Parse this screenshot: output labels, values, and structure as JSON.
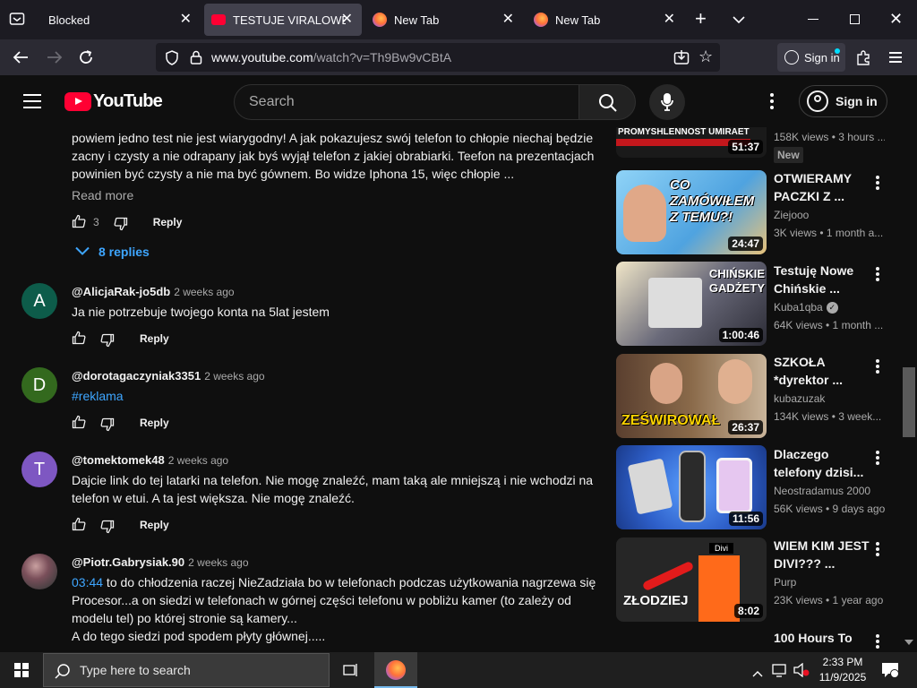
{
  "browser": {
    "tabs": [
      {
        "label": "Blocked"
      },
      {
        "label": "TESTUJE VIRALOWE GA"
      },
      {
        "label": "New Tab"
      },
      {
        "label": "New Tab"
      }
    ],
    "url_host": "www.youtube.com",
    "url_path": "/watch?v=Th9Bw9vCBtA",
    "signin_label": "Sign in"
  },
  "youtube": {
    "logo_text": "YouTube",
    "search_placeholder": "Search",
    "signin_label": "Sign in"
  },
  "comments": {
    "first": {
      "text": "powiem jedno test nie jest wiarygodny! A jak pokazujesz swój telefon to chłopie niechaj będzie zacny i czysty a nie odrapany jak byś wyjął telefon z jakiej obrabiarki. Teefon na prezentacjach powinien być czysty a nie ma być gównem. Bo widze Iphona 15, więc chłopie ...",
      "read_more": "Read more",
      "likes": "3",
      "reply_label": "Reply",
      "replies_label": "8 replies"
    },
    "items": [
      {
        "author": "@AlicjaRak-jo5db",
        "time": "2 weeks ago",
        "text": "Ja nie potrzebuje twojego konta na 5lat jestem",
        "initial": "A",
        "avatar_color": "#0d5c4a",
        "reply_label": "Reply"
      },
      {
        "author": "@dorotagaczyniak3351",
        "time": "2 weeks ago",
        "text": "#reklama",
        "initial": "D",
        "avatar_color": "#33691e",
        "reply_label": "Reply"
      },
      {
        "author": "@tomektomek48",
        "time": "2 weeks ago",
        "text": "Dajcie link do tej latarki na telefon. Nie mogę znaleźć, mam taką ale mniejszą i nie wchodzi na telefon w etui. A ta jest większa. Nie mogę znaleźć.",
        "initial": "T",
        "avatar_color": "#7e57c2",
        "reply_label": "Reply"
      },
      {
        "author": "@Piotr.Gabrysiak.90",
        "time": "2 weeks ago",
        "timestamp": "03:44",
        "text": " to do chłodzenia raczej NieZadziała bo w telefonach podczas użytkowania nagrzewa się Procesor...a on siedzi w telefonach w górnej części telefonu w pobliżu kamer (to zależy od modelu tel) po której stronie są kamery...",
        "text2": "A do tego siedzi pod spodem płyty głównej.....",
        "initial": "",
        "avatar_color": "#5a4a4a"
      }
    ]
  },
  "sidebar": {
    "top_partial": {
      "thumb_text": "PROMYSHLENNOST UMIRAET",
      "duration": "51:37",
      "meta": "158K views • 3 hours ..."
    },
    "videos": [
      {
        "title": "OTWIERAMY PACZKI Z ...",
        "channel": "Ziejooo",
        "meta": "3K views • 1 month a...",
        "duration": "24:47",
        "badge": "New",
        "thumb_text": "CO ZAMÓWIŁEM Z TEMU?!",
        "bg": "#5fb6e8"
      },
      {
        "title": "Testuję Nowe Chińskie ...",
        "channel": "Kuba1qba",
        "meta": "64K views • 1 month ...",
        "duration": "1:00:46",
        "thumb_text": "CHIŃSKIE GADŻETY",
        "verified": "✓",
        "bg": "#3a3a4a"
      },
      {
        "title": "SZKOŁA *dyrektor ...",
        "channel": "kubazuzak",
        "meta": "134K views • 3 week...",
        "duration": "26:37",
        "thumb_text": "ZEŚWIROWAŁ",
        "bg": "#6b4a3a"
      },
      {
        "title": "Dlaczego telefony dzisi...",
        "channel": "Neostradamus 2000",
        "meta": "56K views • 9 days ago",
        "duration": "11:56",
        "bg": "#2e5fc9"
      },
      {
        "title": "WIEM KIM JEST DIVI??? ...",
        "channel": "Purp",
        "meta": "23K views • 1 year ago",
        "duration": "8:02",
        "thumb_text": "ZŁODZIEJ",
        "thumb_label": "Divi",
        "bg": "#2a2a2a"
      },
      {
        "title": "100 Hours To"
      }
    ]
  },
  "taskbar": {
    "search_placeholder": "Type here to search",
    "time": "2:33 PM",
    "date": "11/9/2025"
  }
}
